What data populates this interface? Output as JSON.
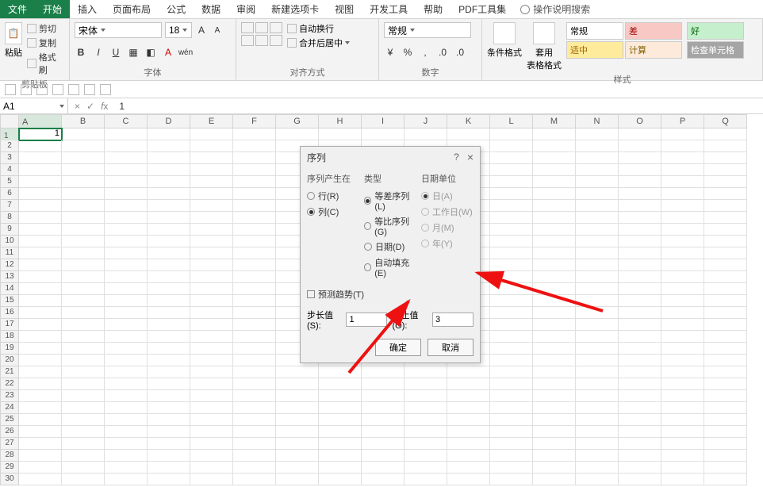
{
  "tabs": {
    "file": "文件",
    "home": "开始",
    "insert": "插入",
    "layout": "页面布局",
    "formulas": "公式",
    "data": "数据",
    "review": "审阅",
    "newtab": "新建选项卡",
    "view": "视图",
    "dev": "开发工具",
    "help": "帮助",
    "pdf": "PDF工具集",
    "tellme": "操作说明搜索"
  },
  "ribbon": {
    "clipboard": {
      "label": "剪贴板",
      "paste": "粘贴",
      "cut": "剪切",
      "copy": "复制",
      "painter": "格式刷"
    },
    "font": {
      "label": "字体",
      "name": "宋体",
      "size": "18",
      "bold": "B",
      "italic": "I",
      "underline": "U"
    },
    "align": {
      "label": "对齐方式",
      "wrap": "自动换行",
      "merge": "合并后居中"
    },
    "number": {
      "label": "数字",
      "format": "常规"
    },
    "cf": "条件格式",
    "tf": "套用\n表格格式",
    "styles": {
      "label": "样式",
      "normal": "常规",
      "bad": "差",
      "good": "好",
      "neutral": "适中",
      "calc": "计算",
      "check": "检查单元格"
    }
  },
  "namebox": "A1",
  "formula": "1",
  "columns": [
    "A",
    "B",
    "C",
    "D",
    "E",
    "F",
    "G",
    "H",
    "I",
    "J",
    "K",
    "L",
    "M",
    "N",
    "O",
    "P",
    "Q"
  ],
  "activeCell": "1",
  "dialog": {
    "title": "序列",
    "help": "?",
    "group_in": "序列产生在",
    "opt_row": "行(R)",
    "opt_col": "列(C)",
    "group_type": "类型",
    "opt_linear": "等差序列(L)",
    "opt_growth": "等比序列(G)",
    "opt_date": "日期(D)",
    "opt_autofill": "自动填充(E)",
    "group_dateunit": "日期单位",
    "opt_day": "日(A)",
    "opt_weekday": "工作日(W)",
    "opt_month": "月(M)",
    "opt_year": "年(Y)",
    "trend": "预测趋势(T)",
    "step_label": "步长值(S):",
    "step_value": "1",
    "stop_label": "终止值(O):",
    "stop_value": "3",
    "ok": "确定",
    "cancel": "取消"
  }
}
